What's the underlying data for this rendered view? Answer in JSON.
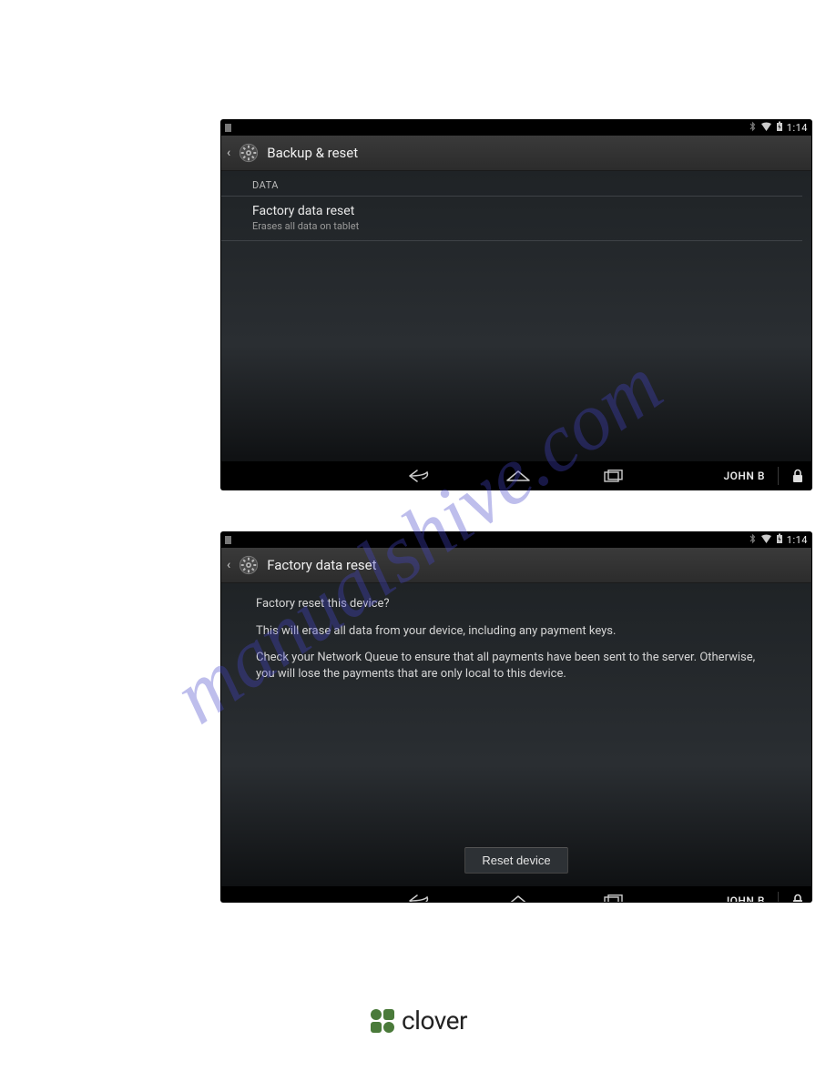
{
  "watermark": "manualshive.com",
  "statusbar": {
    "time": "1:14"
  },
  "screen1": {
    "title": "Backup & reset",
    "section_label": "DATA",
    "item": {
      "primary": "Factory data reset",
      "secondary": "Erases all data on tablet"
    }
  },
  "screen2": {
    "title": "Factory data reset",
    "line1": "Factory reset this device?",
    "line2": "This will erase all data from your device, including any payment keys.",
    "line3": "Check your Network Queue to ensure that all payments have been sent to the server. Otherwise, you will lose the payments that are only local to this device.",
    "reset_button": "Reset device"
  },
  "navbar": {
    "user": "JOHN B"
  },
  "footer": {
    "brand": "clover"
  }
}
